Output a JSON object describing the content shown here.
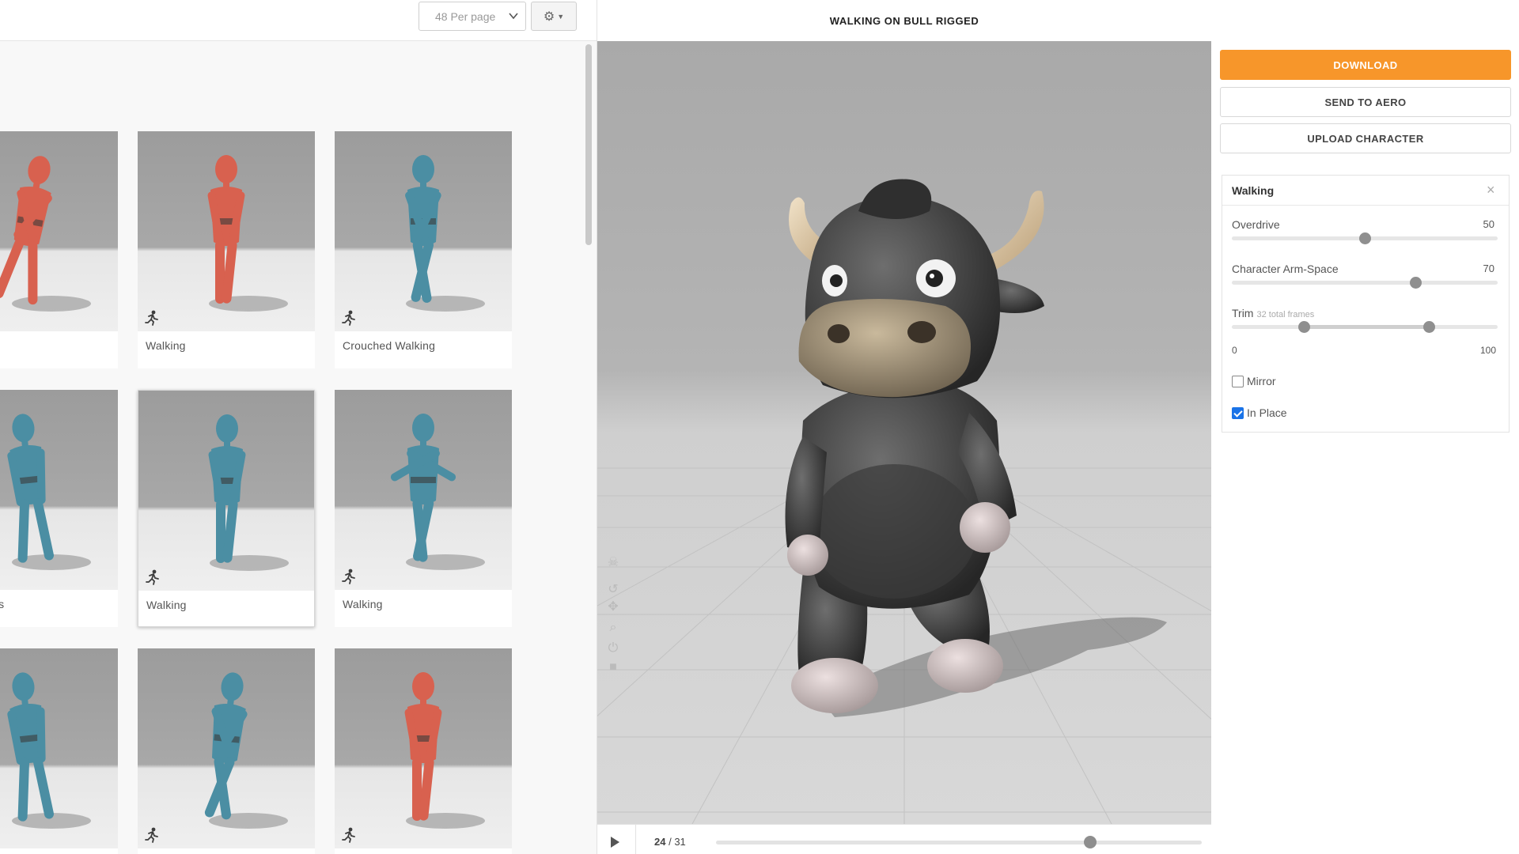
{
  "library": {
    "per_page": "48 Per page",
    "cards": [
      {
        "label": "",
        "color": "#d8614f",
        "pose": "lean"
      },
      {
        "label": "Walking",
        "color": "#d8614f",
        "pose": "stand"
      },
      {
        "label": "Crouched Walking",
        "color": "#4b8ea3",
        "pose": "crouch"
      },
      {
        "label": "Backwards",
        "color": "#4b8ea3",
        "pose": "side"
      },
      {
        "label": "Walking",
        "color": "#4b8ea3",
        "pose": "stand"
      },
      {
        "label": "Walking",
        "color": "#4b8ea3",
        "pose": "arms"
      },
      {
        "label": "",
        "color": "#4b8ea3",
        "pose": "side"
      },
      {
        "label": "",
        "color": "#4b8ea3",
        "pose": "stride"
      },
      {
        "label": "",
        "color": "#d8614f",
        "pose": "stand"
      }
    ]
  },
  "viewport": {
    "title": "WALKING ON BULL RIGGED",
    "frame_current": "24",
    "frame_total": "/ 31",
    "progress": 0.77
  },
  "actions": {
    "download": "DOWNLOAD",
    "send_to_aero": "SEND TO AERO",
    "upload_character": "UPLOAD CHARACTER"
  },
  "settings": {
    "title": "Walking",
    "overdrive_label": "Overdrive",
    "overdrive_value": "50",
    "overdrive_fraction": 0.5,
    "armspace_label": "Character Arm-Space",
    "armspace_value": "70",
    "armspace_fraction": 0.69,
    "trim_label": "Trim",
    "trim_note": "32 total frames",
    "trim_min": "0",
    "trim_max": "100",
    "trim_start_fraction": 0.27,
    "trim_end_fraction": 0.74,
    "mirror_label": "Mirror",
    "mirror_checked": false,
    "inplace_label": "In Place",
    "inplace_checked": true
  },
  "colors": {
    "accent": "#f7962a",
    "checkbox": "#1a73e8"
  }
}
